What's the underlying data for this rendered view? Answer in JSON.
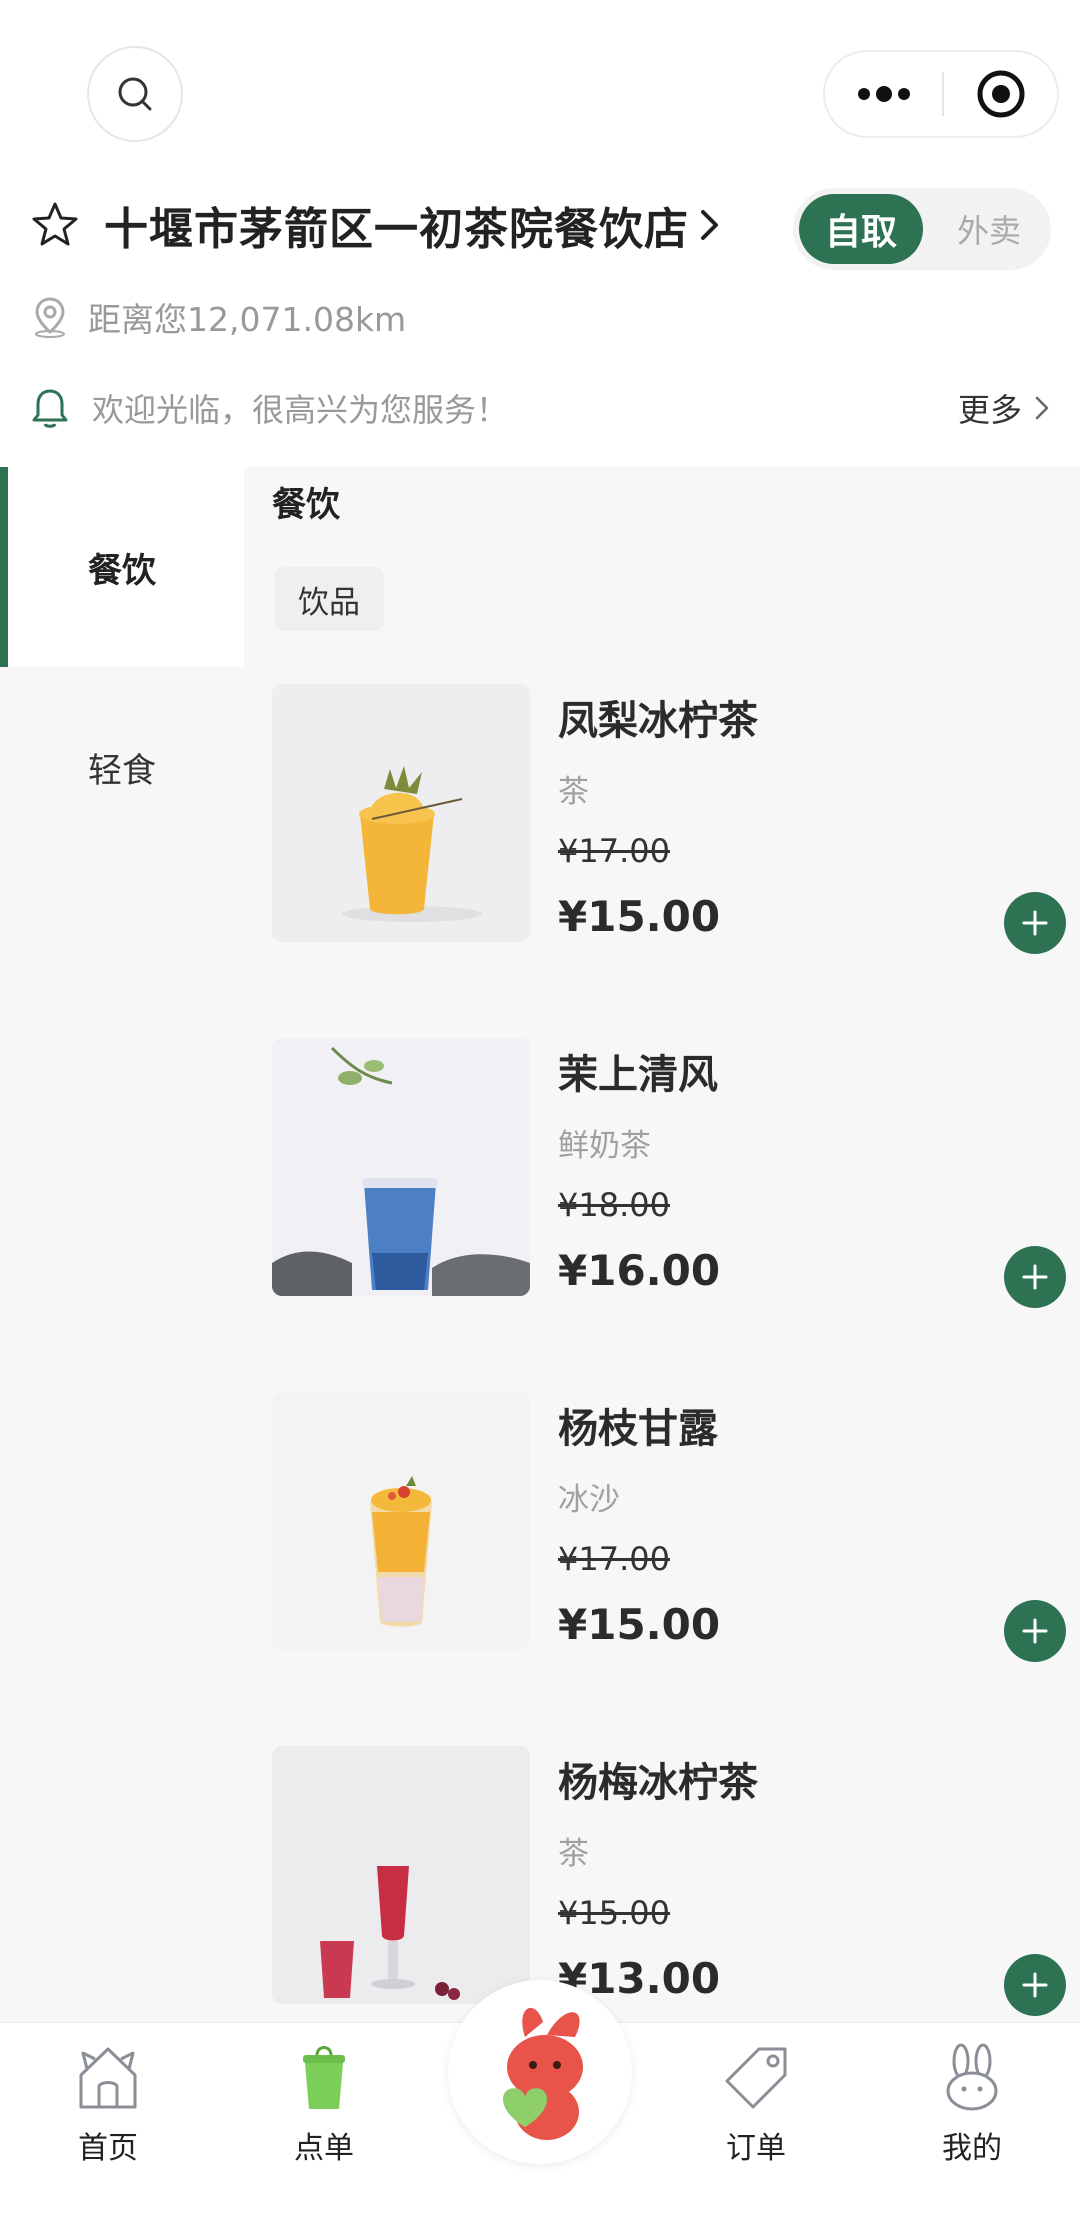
{
  "store": {
    "name": "十堰市茅箭区一初茶院餐饮店",
    "distance": "距离您12,071.08km",
    "notice": "欢迎光临，很高兴为您服务！",
    "notice_more": "更多",
    "modes": {
      "active": "自取",
      "inactive": "外卖"
    }
  },
  "sidebar": {
    "items": [
      {
        "label": "餐饮",
        "active": true
      },
      {
        "label": "轻食",
        "active": false
      }
    ]
  },
  "menu": {
    "section_title": "餐饮",
    "chip": "饮品",
    "products": [
      {
        "name": "凤梨冰柠茶",
        "category": "茶",
        "original_price": "¥17.00",
        "price": "¥15.00"
      },
      {
        "name": "茉上清风",
        "category": "鲜奶茶",
        "original_price": "¥18.00",
        "price": "¥16.00"
      },
      {
        "name": "杨枝甘露",
        "category": "冰沙",
        "original_price": "¥17.00",
        "price": "¥15.00"
      },
      {
        "name": "杨梅冰柠茶",
        "category": "茶",
        "original_price": "¥15.00",
        "price": "¥13.00"
      }
    ]
  },
  "tabbar": {
    "items": [
      {
        "label": "首页",
        "icon": "home-icon"
      },
      {
        "label": "点单",
        "icon": "order-cup-icon"
      },
      {
        "label": "订单",
        "icon": "tag-icon"
      },
      {
        "label": "我的",
        "icon": "bunny-icon"
      }
    ],
    "center_icon": "mascot-icon"
  },
  "colors": {
    "accent": "#2d7353",
    "sidebar_bg": "#f7f7f7",
    "muted_text": "#999999"
  }
}
